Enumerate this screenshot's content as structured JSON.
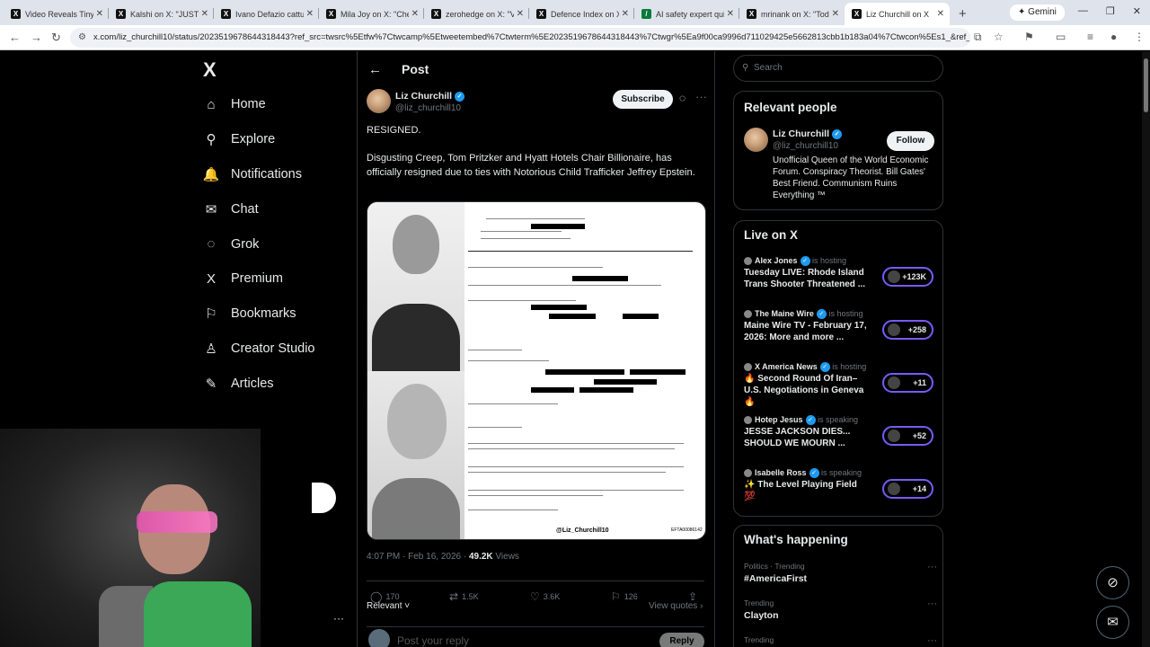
{
  "browser": {
    "tabs": [
      {
        "title": "Video Reveals Tiny",
        "icon": "x-icon"
      },
      {
        "title": "Kalshi on X: \"JUST I",
        "icon": "x-icon"
      },
      {
        "title": "Ivano Defazio cattu",
        "icon": "x-icon"
      },
      {
        "title": "Mila Joy on X: \"Che",
        "icon": "x-icon"
      },
      {
        "title": "zerohedge on X: \"V",
        "icon": "x-icon"
      },
      {
        "title": "Defence Index on X",
        "icon": "x-icon"
      },
      {
        "title": "AI safety expert qui",
        "icon": "green-icon"
      },
      {
        "title": "mrinank on X: \"Toda",
        "icon": "x-icon"
      },
      {
        "title": "Liz Churchill on X",
        "icon": "x-icon",
        "active": true
      }
    ],
    "new_tab": "+",
    "gemini_label": "Gemini",
    "url": "x.com/liz_churchill10/status/2023519678644318443?ref_src=twsrc%5Etfw%7Ctwcamp%5Etweetembed%7Ctwterm%5E2023519678644318443%7Ctwgr%5Ea9f00ca9996d711029425e5662813cbb1b183a04%7Ctwcon%5Es1_&ref_url=http..."
  },
  "sidebar": {
    "logo": "X",
    "items": [
      {
        "label": "Home",
        "icon": "⌂"
      },
      {
        "label": "Explore",
        "icon": "⚲"
      },
      {
        "label": "Notifications",
        "icon": "🔔"
      },
      {
        "label": "Chat",
        "icon": "✉"
      },
      {
        "label": "Grok",
        "icon": "◌"
      },
      {
        "label": "Premium",
        "icon": "X"
      },
      {
        "label": "Bookmarks",
        "icon": "⚐"
      },
      {
        "label": "Creator Studio",
        "icon": "♙"
      },
      {
        "label": "Articles",
        "icon": "✎"
      }
    ]
  },
  "post": {
    "header_title": "Post",
    "author_name": "Liz Churchill",
    "author_handle": "@liz_churchill10",
    "subscribe_label": "Subscribe",
    "text_line1": "RESIGNED.",
    "text_body": "Disgusting Creep, Tom Pritzker and Hyatt Hotels Chair Billionaire, has officially resigned due to ties with Notorious Child Trafficker Jeffrey Epstein.",
    "media_watermark": "@Liz_Churchill10",
    "media_code": "EFTA00086142",
    "timestamp": "4:07 PM · Feb 16, 2026 · ",
    "views": "49.2K",
    "views_label": " Views",
    "replies": "170",
    "reposts": "1.5K",
    "likes": "3.6K",
    "bookmarks": "126",
    "sort_label": "Relevant",
    "view_quotes": "View quotes",
    "reply_placeholder": "Post your reply",
    "reply_button": "Reply"
  },
  "search": {
    "placeholder": "Search"
  },
  "relevant_people": {
    "title": "Relevant people",
    "name": "Liz Churchill",
    "handle": "@liz_churchill10",
    "follow_label": "Follow",
    "bio": "Unofficial Queen of the World Economic Forum. Conspiracy Theorist. Bill Gates' Best Friend. Communism Ruins Everything ™"
  },
  "live_on_x": {
    "title": "Live on X",
    "items": [
      {
        "host": "Alex Jones",
        "status": " is hosting",
        "title": "Tuesday LIVE: Rhode Island Trans Shooter Threatened ...",
        "count": "+123K"
      },
      {
        "host": "The Maine Wire",
        "status": " is hosting",
        "title": "Maine Wire TV - February 17, 2026: More and more ...",
        "count": "+258"
      },
      {
        "host": "X America News",
        "status": " is hosting",
        "title": "🔥 Second Round Of Iran–U.S. Negotiations in Geneva 🔥",
        "count": "+11"
      },
      {
        "host": "Hotep Jesus",
        "status": " is speaking",
        "title": "JESSE JACKSON DIES... SHOULD WE MOURN ...",
        "count": "+52"
      },
      {
        "host": "Isabelle Ross",
        "status": " is speaking",
        "title": "✨ The Level Playing Field 💯",
        "count": "+14"
      }
    ]
  },
  "whats_happening": {
    "title": "What's happening",
    "items": [
      {
        "category": "Politics · Trending",
        "name": "#AmericaFirst"
      },
      {
        "category": "Trending",
        "name": "Clayton"
      },
      {
        "category": "Trending",
        "name": ""
      }
    ]
  },
  "colors": {
    "accent": "#1d9bf0",
    "live_border": "#7a5af8",
    "background": "#000000"
  }
}
